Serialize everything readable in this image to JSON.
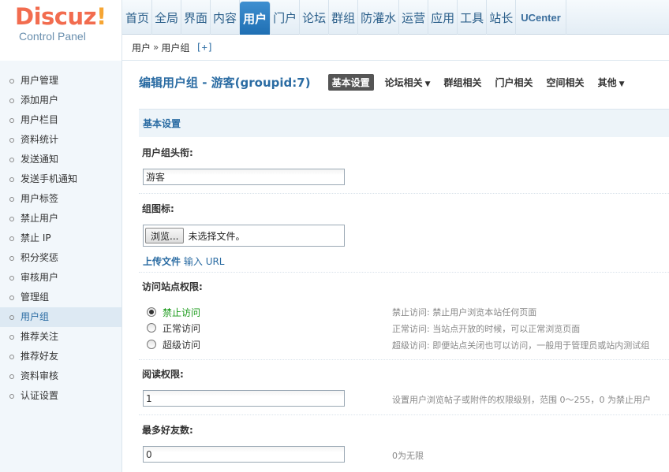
{
  "logo": {
    "main": "Discuz",
    "bang": "!",
    "sub": "Control Panel"
  },
  "nav": {
    "items": [
      "首页",
      "全局",
      "界面",
      "内容",
      "用户",
      "门户",
      "论坛",
      "群组",
      "防灌水",
      "运营",
      "应用",
      "工具",
      "站长",
      "UCenter"
    ],
    "active": "用户"
  },
  "breadcrumb": {
    "root": "用户",
    "sep": "»",
    "current": "用户组",
    "add": "[+]"
  },
  "sidebar": {
    "items": [
      "用户管理",
      "添加用户",
      "用户栏目",
      "资料统计",
      "发送通知",
      "发送手机通知",
      "用户标签",
      "禁止用户",
      "禁止 IP",
      "积分奖惩",
      "审核用户",
      "管理组",
      "用户组",
      "推荐关注",
      "推荐好友",
      "资料审核",
      "认证设置"
    ],
    "active": "用户组"
  },
  "main": {
    "title": "编辑用户组 - 游客(groupid:7)",
    "tabs": [
      {
        "label": "基本设置",
        "dropdown": false
      },
      {
        "label": "论坛相关",
        "dropdown": true
      },
      {
        "label": "群组相关",
        "dropdown": false
      },
      {
        "label": "门户相关",
        "dropdown": false
      },
      {
        "label": "空间相关",
        "dropdown": false
      },
      {
        "label": "其他",
        "dropdown": true
      }
    ],
    "caret": "▼",
    "section_title": "基本设置",
    "group_title": {
      "label": "用户组头衔:",
      "value": "游客"
    },
    "group_icon": {
      "label": "组图标:",
      "browse": "浏览...",
      "status": "未选择文件。",
      "upload": "上传文件",
      "input": "输入",
      "url": "URL"
    },
    "access": {
      "label": "访问站点权限:",
      "options": [
        "禁止访问",
        "正常访问",
        "超级访问"
      ],
      "selected": "禁止访问",
      "hints": [
        "禁止访问: 禁止用户浏览本站任何页面",
        "正常访问: 当站点开放的时候，可以正常浏览页面",
        "超级访问: 即便站点关闭也可以访问，一般用于管理员或站内测试组"
      ]
    },
    "read_perm": {
      "label": "阅读权限:",
      "value": "1",
      "hint": "设置用户浏览帖子或附件的权限级别，范围 0～255，0 为禁止用户"
    },
    "max_friends": {
      "label": "最多好友数:",
      "value": "0",
      "hint": "0为无限"
    }
  },
  "colors": {
    "brand": "#f26c4f",
    "accent": "#2b6ca3",
    "selected_option": "#1a9a1a"
  }
}
